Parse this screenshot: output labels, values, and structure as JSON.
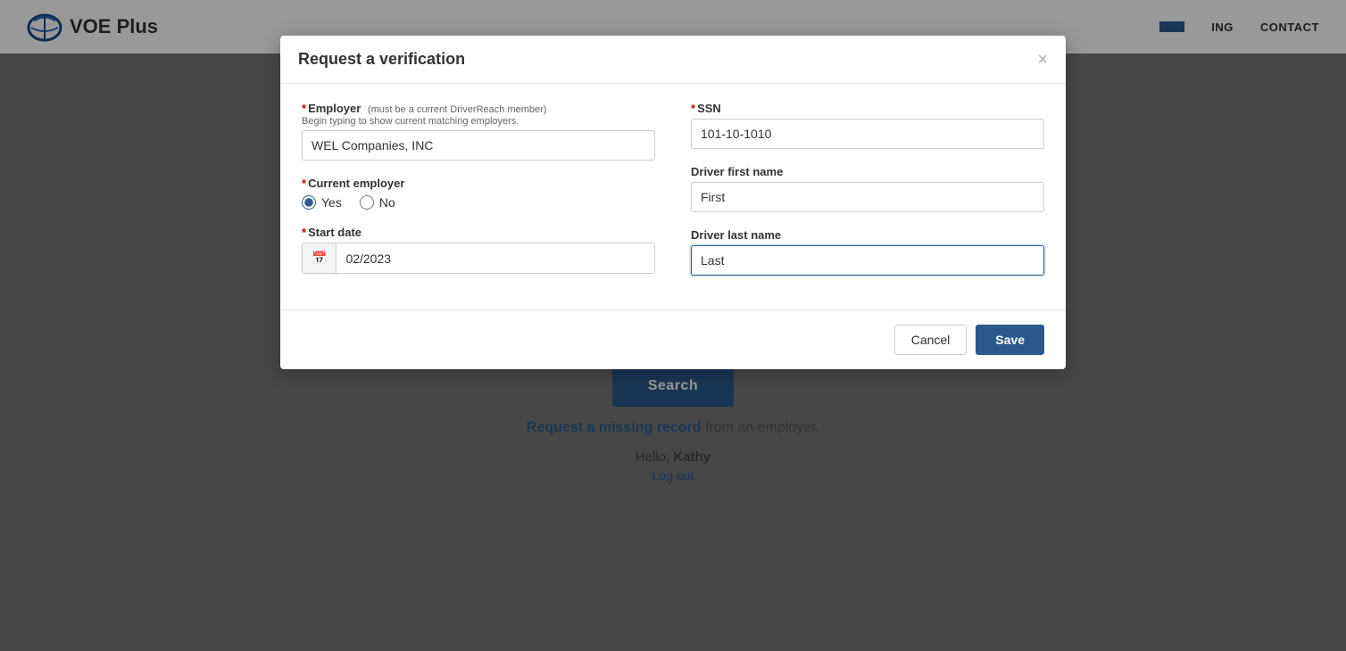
{
  "header": {
    "logo_text": "VOE Plus",
    "nav": {
      "item1": "ING",
      "item2": "CONTACT"
    }
  },
  "background": {
    "search_button_label": "Search",
    "missing_record_link_text": "Request a missing record",
    "missing_record_suffix": " from an employer.",
    "hello_prefix": "Hello, ",
    "hello_name": "Kathy",
    "logout_label": "Log out"
  },
  "modal": {
    "title": "Request a verification",
    "close_label": "×",
    "employer_label": "Employer",
    "employer_sublabel": "(must be a current DriverReach member)",
    "employer_hint": "Begin typing to show current matching employers.",
    "employer_value": "WEL Companies, INC",
    "current_employer_label": "Current employer",
    "radio_yes": "Yes",
    "radio_no": "No",
    "start_date_label": "Start date",
    "start_date_value": "02/2023",
    "ssn_label": "SSN",
    "ssn_value": "101-10-1010",
    "driver_first_name_label": "Driver first name",
    "driver_first_name_value": "First",
    "driver_last_name_label": "Driver last name",
    "driver_last_name_value": "Last",
    "cancel_label": "Cancel",
    "save_label": "Save",
    "required_marker": "*"
  }
}
